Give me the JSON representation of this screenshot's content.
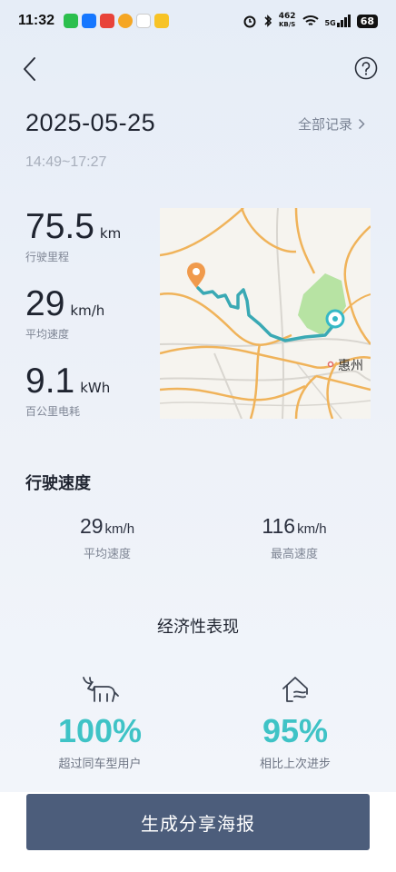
{
  "status_bar": {
    "time": "11:32",
    "net_speed_value": "462",
    "net_speed_unit": "KB/S",
    "network": "5G",
    "battery": "68"
  },
  "header": {
    "date": "2025-05-25",
    "all_records_label": "全部记录",
    "time_range": "14:49~17:27"
  },
  "stats": [
    {
      "value": "75.5",
      "unit": "km",
      "label": "行驶里程"
    },
    {
      "value": "29",
      "unit": "km/h",
      "label": "平均速度"
    },
    {
      "value": "9.1",
      "unit": "kWh",
      "label": "百公里电耗"
    }
  ],
  "map": {
    "city_label": "惠州",
    "start_marker_color": "#f09a4c",
    "end_marker_color": "#35b8c6",
    "route_color": "#3aa9b4"
  },
  "speed_section": {
    "title": "行驶速度",
    "avg": {
      "value": "29",
      "unit": "km/h",
      "label": "平均速度"
    },
    "max": {
      "value": "116",
      "unit": "km/h",
      "label": "最高速度"
    }
  },
  "economy": {
    "title": "经济性表现",
    "items": [
      {
        "value": "100%",
        "label": "超过同车型用户",
        "icon": "bull-icon"
      },
      {
        "value": "95%",
        "label": "相比上次进步",
        "icon": "house-wind-icon"
      }
    ],
    "accent_color": "#3fc3c6"
  },
  "share_button_label": "生成分享海报"
}
